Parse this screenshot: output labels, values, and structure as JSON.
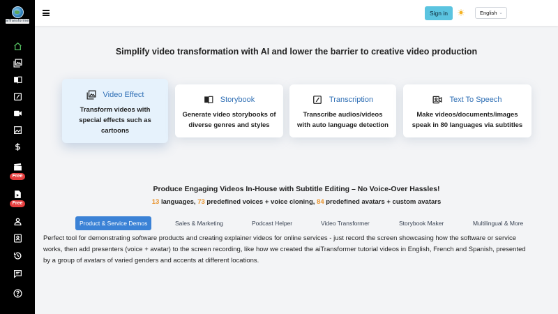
{
  "app": {
    "logo_text": "aiTransformer"
  },
  "sidebar": {
    "items": [
      {
        "name": "home",
        "icon": "home-icon",
        "badge": ""
      },
      {
        "name": "gallery",
        "icon": "gallery-icon",
        "badge": ""
      },
      {
        "name": "storybook",
        "icon": "book-icon",
        "badge": ""
      },
      {
        "name": "transcription",
        "icon": "edit-icon",
        "badge": ""
      },
      {
        "name": "video",
        "icon": "video-icon",
        "badge": ""
      },
      {
        "name": "image",
        "icon": "image-icon",
        "badge": ""
      },
      {
        "name": "pricing",
        "icon": "dollar-icon",
        "badge": ""
      },
      {
        "name": "clapper",
        "icon": "clapperboard-icon",
        "badge": "Free"
      },
      {
        "name": "file-video",
        "icon": "file-video-icon",
        "badge": "Free"
      },
      {
        "name": "account",
        "icon": "user-icon",
        "badge": ""
      },
      {
        "name": "contacts",
        "icon": "contact-icon",
        "badge": ""
      },
      {
        "name": "history",
        "icon": "history-icon",
        "badge": ""
      },
      {
        "name": "feedback",
        "icon": "message-icon",
        "badge": ""
      },
      {
        "name": "help",
        "icon": "help-icon",
        "badge": ""
      }
    ]
  },
  "header": {
    "signin_label": "Sign in",
    "language": "English",
    "active_color": "#56c262"
  },
  "main": {
    "headline": "Simplify video transformation with AI and lower the barrier to creative video production",
    "cards": [
      {
        "title": "Video Effect",
        "icon": "image-stack-icon",
        "description": [
          "Transform videos with",
          "special effects such as",
          "cartoons"
        ]
      },
      {
        "title": "Storybook",
        "icon": "open-book-icon",
        "description": [
          "Generate video storybooks of",
          "diverse genres and styles"
        ]
      },
      {
        "title": "Transcription",
        "icon": "transcribe-icon",
        "description": [
          "Transcribe audios/videos",
          "with auto language detection"
        ]
      },
      {
        "title": "Text To Speech",
        "icon": "tts-video-icon",
        "description": [
          "Make videos/documents/images",
          "speak in 80 languages via subtitles"
        ]
      }
    ],
    "subheadline": "Produce Engaging Videos In-House with Subtitle Editing – No Voice-Over Hassles!",
    "stats": {
      "languages_count": "13",
      "languages_text": " languages, ",
      "voices_count": "73",
      "voices_text": " predefined voices + voice cloning, ",
      "avatars_count": "84",
      "avatars_text": " predefined avatars + custom avatars"
    },
    "tabs": [
      "Product & Service Demos",
      "Sales & Marketing",
      "Podcast Helper",
      "Video Transformer",
      "Storybook Maker",
      "Multilingual & More"
    ],
    "active_tab": "Product & Service Demos",
    "description": "Perfect tool for demonstrating software products and creating explainer videos for online services - just record the screen showcasing how the software or service works, then add presenters (voice + avatar) to the screen recording, like how we created the aiTransformer tutorial videos in English, French and Spanish, presented by a group of avatars of varied genders and accents at different locations."
  }
}
